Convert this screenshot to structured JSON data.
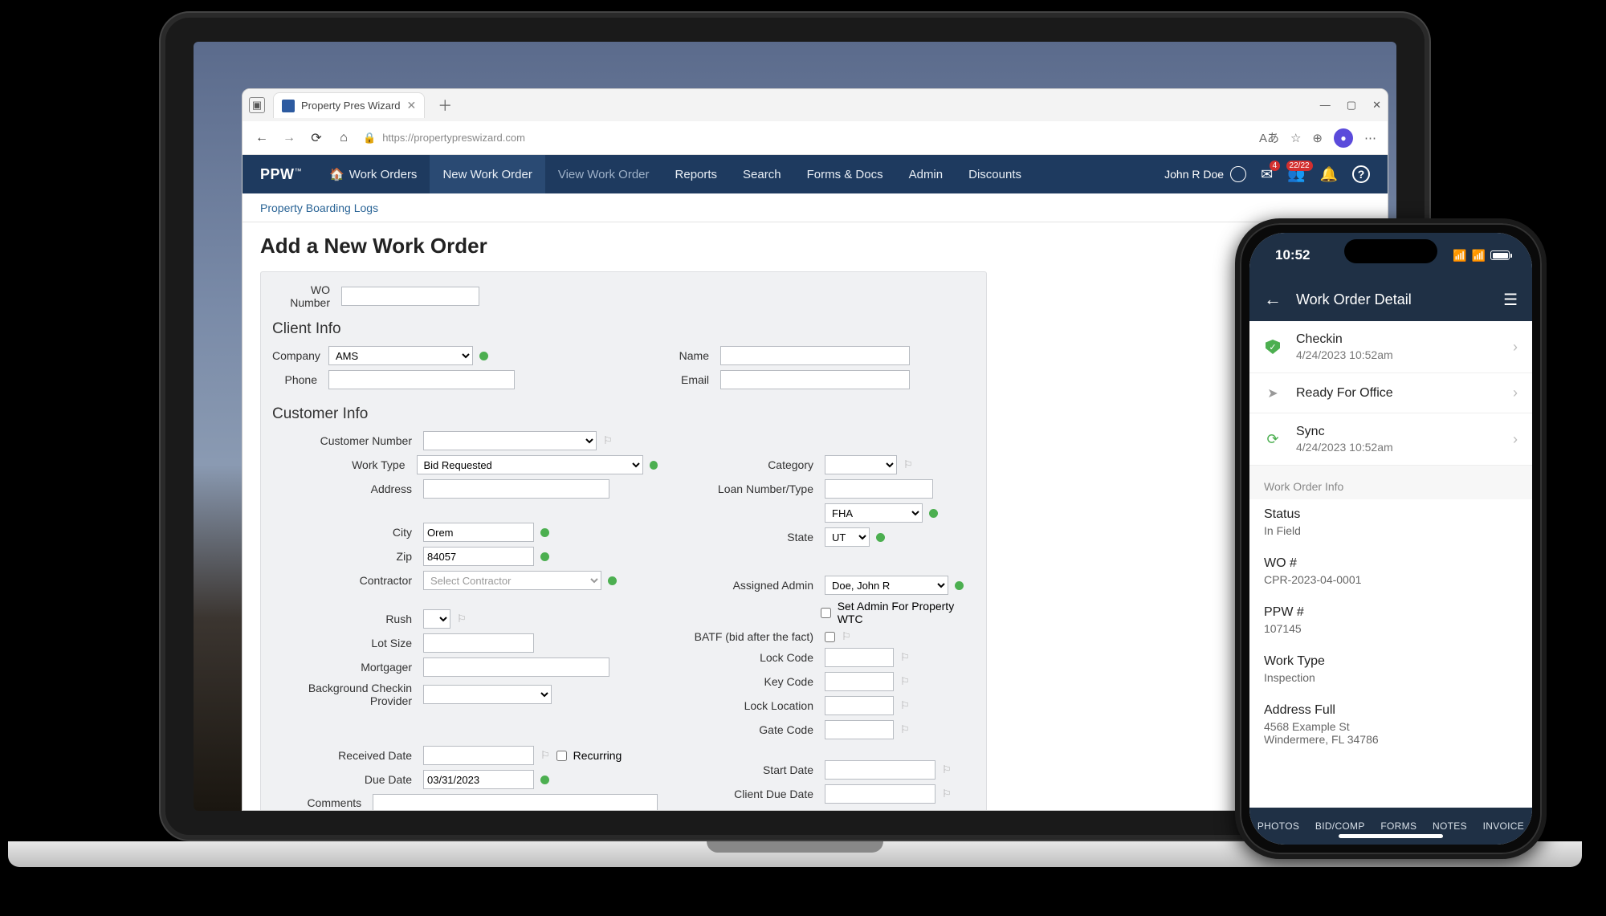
{
  "browser": {
    "tab_title": "Property Pres Wizard",
    "url": "https://propertypreswizard.com"
  },
  "nav": {
    "brand": "PPW",
    "items": [
      "Work Orders",
      "New Work Order",
      "View Work Order",
      "Reports",
      "Search",
      "Forms & Docs",
      "Admin",
      "Discounts"
    ],
    "user": "John R Doe",
    "badge_mail": "4",
    "badge_people": "22/22"
  },
  "subnav": {
    "link": "Property Boarding Logs"
  },
  "page": {
    "title": "Add a New Work Order"
  },
  "form": {
    "wo_number_lbl": "WO Number",
    "client_info": "Client Info",
    "company_lbl": "Company",
    "company_val": "AMS",
    "name_lbl": "Name",
    "phone_lbl": "Phone",
    "email_lbl": "Email",
    "customer_info": "Customer Info",
    "customer_number_lbl": "Customer Number",
    "work_type_lbl": "Work Type",
    "work_type_val": "Bid Requested",
    "category_lbl": "Category",
    "address_lbl": "Address",
    "loan_lbl": "Loan Number/Type",
    "loan_type_val": "FHA",
    "city_lbl": "City",
    "city_val": "Orem",
    "state_lbl": "State",
    "state_val": "UT",
    "zip_lbl": "Zip",
    "zip_val": "84057",
    "contractor_lbl": "Contractor",
    "contractor_placeholder": "Select Contractor",
    "admin_lbl": "Assigned Admin",
    "admin_val": "Doe, John R",
    "set_admin_lbl": "Set Admin For Property WTC",
    "rush_lbl": "Rush",
    "batf_lbl": "BATF (bid after the fact)",
    "lot_lbl": "Lot Size",
    "lock_code_lbl": "Lock Code",
    "mortgager_lbl": "Mortgager",
    "key_code_lbl": "Key Code",
    "bcp_lbl": "Background Checkin Provider",
    "lock_loc_lbl": "Lock Location",
    "gate_code_lbl": "Gate Code",
    "received_lbl": "Received Date",
    "recurring_lbl": "Recurring",
    "start_lbl": "Start Date",
    "due_lbl": "Due Date",
    "due_val": "03/31/2023",
    "client_due_lbl": "Client Due Date",
    "comments_lbl": "Comments"
  },
  "phone": {
    "time": "10:52",
    "title": "Work Order Detail",
    "items": [
      {
        "icon": "shield",
        "title": "Checkin",
        "sub": "4/24/2023 10:52am"
      },
      {
        "icon": "send",
        "title": "Ready For Office",
        "sub": ""
      },
      {
        "icon": "sync",
        "title": "Sync",
        "sub": "4/24/2023 10:52am"
      }
    ],
    "section": "Work Order Info",
    "info": [
      {
        "label": "Status",
        "value": "In Field"
      },
      {
        "label": "WO #",
        "value": "CPR-2023-04-0001"
      },
      {
        "label": "PPW #",
        "value": "107145"
      },
      {
        "label": "Work Type",
        "value": "Inspection"
      },
      {
        "label": "Address Full",
        "value": "4568 Example St\nWindermere, FL 34786"
      }
    ],
    "tabs": [
      "PHOTOS",
      "BID/COMP",
      "FORMS",
      "NOTES",
      "INVOICE"
    ]
  }
}
